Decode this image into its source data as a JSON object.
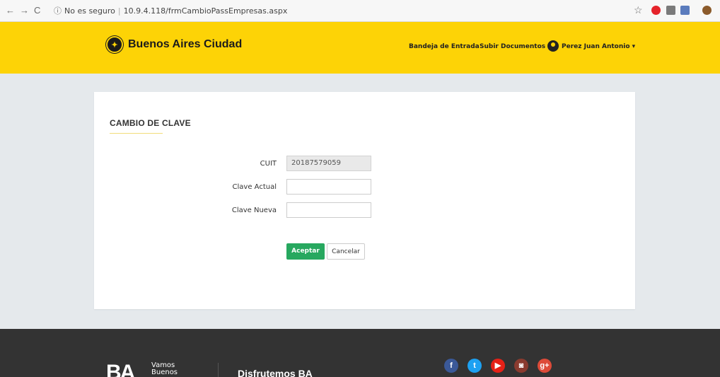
{
  "browser": {
    "back": "←",
    "forward": "→",
    "reload": "C",
    "security_label": "No es seguro",
    "url": "10.9.4.118/frmCambioPassEmpresas.aspx",
    "star": "☆"
  },
  "header": {
    "logo_text": "Buenos Aires Ciudad",
    "nav": [
      "Bandeja de Entrada",
      "Subir Documentos"
    ],
    "user_name": "Perez Juan Antonio ▾",
    "background_color": "#fdd306"
  },
  "form": {
    "title": "CAMBIO DE CLAVE",
    "fields": [
      {
        "label": "CUIT",
        "value": "20187579059",
        "readonly": true
      },
      {
        "label": "Clave Actual",
        "value": ""
      },
      {
        "label": "Clave Nueva",
        "value": ""
      }
    ],
    "buttons": {
      "accept": "Aceptar",
      "cancel": "Cancelar"
    },
    "accent_color": "#27a85f"
  },
  "footer": {
    "ba_logo": "BA",
    "vamos_text": "Vamos\nBuenos",
    "tagline": "Disfrutemos BA",
    "social": [
      {
        "icon": "facebook-icon",
        "glyph": "f",
        "color": "#3b5998"
      },
      {
        "icon": "twitter-icon",
        "glyph": "t",
        "color": "#1da1f2"
      },
      {
        "icon": "youtube-icon",
        "glyph": "▶",
        "color": "#e62117"
      },
      {
        "icon": "instagram-icon",
        "glyph": "◙",
        "color": "#8a3b2f"
      },
      {
        "icon": "google-plus-icon",
        "glyph": "g+",
        "color": "#dd4b39"
      }
    ]
  }
}
